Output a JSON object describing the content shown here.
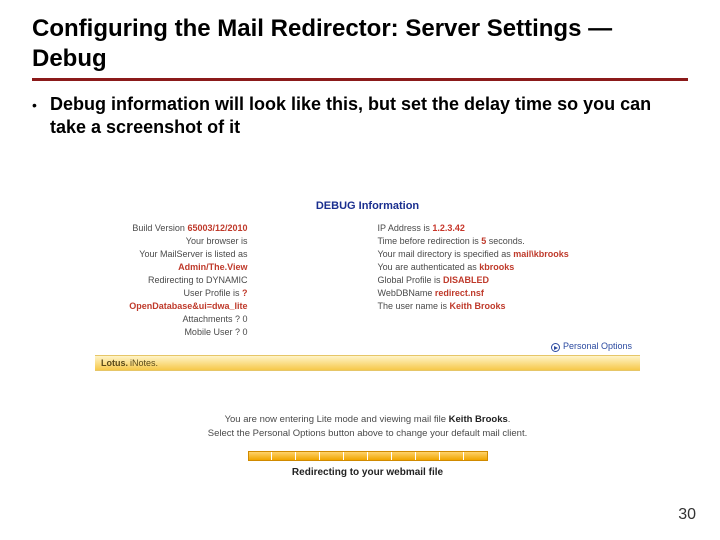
{
  "title": "Configuring the Mail Redirector: Server Settings — Debug",
  "bullet": "Debug information will look like this, but set the delay time so you can take a screenshot of it",
  "page_number": "30",
  "screenshot": {
    "debug_header": "DEBUG Information",
    "left": {
      "build_label": "Build Version",
      "build_value": "65003/12/2010",
      "browser_label": "Your browser is",
      "mailserver_label": "Your MailServer is listed as",
      "mailserver_value": "Admin/The.View",
      "redirecting_label": "Redirecting to DYNAMIC",
      "profile_label": "User Profile is",
      "profile_value": "?OpenDatabase&ui=dwa_lite",
      "attachments_label": "Attachments ?",
      "attachments_value": "0",
      "mobile_label": "Mobile User ?",
      "mobile_value": "0"
    },
    "right": {
      "ip_label": "IP Address is",
      "ip_value": "1.2.3.42",
      "delay_label_a": "Time before redirection is",
      "delay_value": "5",
      "delay_label_b": "seconds.",
      "maildir_label": "Your mail directory is specified as",
      "maildir_value": "mail\\kbrooks",
      "auth_label": "You are authenticated as",
      "auth_value": "kbrooks",
      "global_label": "Global Profile is",
      "global_value": "DISABLED",
      "webdb_label": "WebDBName",
      "webdb_value": "redirect.nsf",
      "uname_label": "The user name is",
      "uname_value": "Keith Brooks"
    },
    "personal_options": "Personal Options",
    "lotus": "Lotus.",
    "inotes": "iNotes.",
    "msg_a": "You are now entering Lite mode and viewing mail file ",
    "msg_name": "Keith Brooks",
    "msg_b": "Select the Personal Options button above to change your default mail client.",
    "redirecting_text": "Redirecting to your webmail file"
  }
}
